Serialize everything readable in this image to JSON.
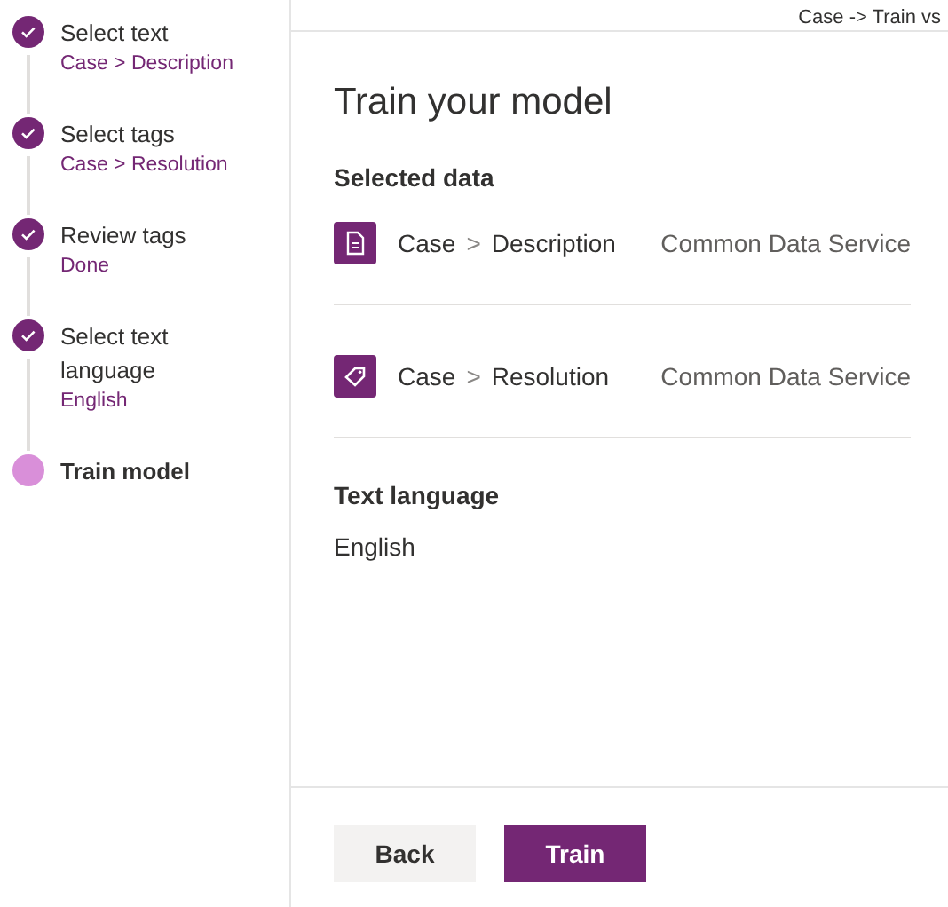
{
  "steps": [
    {
      "title": "Select text",
      "subtitle": "Case > Description",
      "done": true
    },
    {
      "title": "Select tags",
      "subtitle": "Case > Resolution",
      "done": true
    },
    {
      "title": "Review tags",
      "subtitle": "Done",
      "done": true
    },
    {
      "title": "Select text language",
      "subtitle": "English",
      "done": true
    },
    {
      "title": "Train model",
      "done": false
    }
  ],
  "header": {
    "breadcrumb": "Case -> Train vs"
  },
  "title": "Train your model",
  "selected_data": {
    "heading": "Selected data",
    "rows": [
      {
        "kind": "document",
        "entity": "Case",
        "separator": ">",
        "field": "Description",
        "source": "Common Data Service"
      },
      {
        "kind": "tag",
        "entity": "Case",
        "separator": ">",
        "field": "Resolution",
        "source": "Common Data Service"
      }
    ]
  },
  "text_language": {
    "heading": "Text language",
    "value": "English"
  },
  "buttons": [
    {
      "label": "Back",
      "kind": "secondary"
    },
    {
      "label": "Train",
      "kind": "primary"
    }
  ]
}
